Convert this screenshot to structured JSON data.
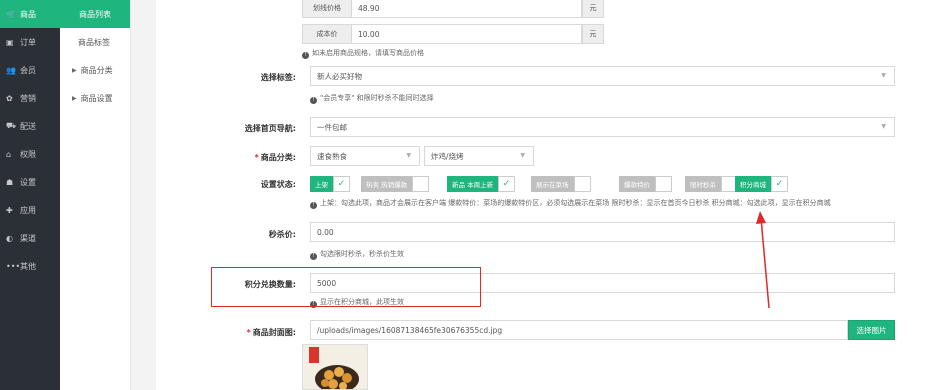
{
  "nav_primary": [
    {
      "icon": "cart-icon",
      "glyph": "🛒",
      "label": "商品",
      "active": true
    },
    {
      "icon": "order-icon",
      "glyph": "▣",
      "label": "订单"
    },
    {
      "icon": "member-icon",
      "glyph": "👥",
      "label": "会员"
    },
    {
      "icon": "marketing-icon",
      "glyph": "✿",
      "label": "营销"
    },
    {
      "icon": "delivery-icon",
      "glyph": "⛟",
      "label": "配送"
    },
    {
      "icon": "permission-icon",
      "glyph": "⌂",
      "label": "权限"
    },
    {
      "icon": "settings-icon",
      "glyph": "☗",
      "label": "设置"
    },
    {
      "icon": "app-icon",
      "glyph": "✚",
      "label": "应用"
    },
    {
      "icon": "channel-icon",
      "glyph": "◐",
      "label": "渠道"
    },
    {
      "icon": "more-icon",
      "glyph": "•••",
      "label": "其他"
    }
  ],
  "nav_secondary": {
    "product_list": "商品列表",
    "product_tags": "商品标签",
    "product_category": "商品分类",
    "product_settings": "商品设置"
  },
  "form": {
    "strike_price": {
      "addon": "划线价格",
      "value": "48.90",
      "unit": "元"
    },
    "cost_price": {
      "addon": "成本价",
      "value": "10.00",
      "unit": "元"
    },
    "price_help": "如未启用商品规格，请填写商品价格",
    "tag": {
      "label": "选择标签:",
      "value": "新人必买好物",
      "help": "\"会员专享\" 和限时秒杀不能同时选择"
    },
    "home_nav": {
      "label": "选择首页导航:",
      "value": "一件包邮"
    },
    "category": {
      "label": "商品分类:",
      "value1": "速食熟食",
      "value2": "炸鸡/烧烤"
    },
    "status": {
      "label": "设置状态:",
      "switches": [
        {
          "label": "上架",
          "on": true
        },
        {
          "label": "热卖 热销爆款",
          "on": false
        },
        {
          "label": "新品 本周上新",
          "on": true
        },
        {
          "label": "展示在菜场",
          "on": false
        },
        {
          "label": "爆款特价",
          "on": false
        },
        {
          "label": "限时秒杀",
          "on": false
        },
        {
          "label": "积分商城",
          "on": true
        }
      ],
      "help": "上架：勾选此项，商品才会展示在客户端    爆款特价：菜场的爆款特价区，必须勾选展示在菜场    限时秒杀：显示在首页今日秒杀    积分商城：勾选此项，显示在积分商城"
    },
    "seckill": {
      "label": "秒杀价:",
      "value": "0.00",
      "help": "勾选限时秒杀，秒杀价生效"
    },
    "points": {
      "label": "积分兑换数量:",
      "value": "5000",
      "help": "显示在积分商城，此项生效"
    },
    "cover": {
      "label": "商品封面图:",
      "value": "/uploads/images/16087138465fe30676355cd.jpg",
      "button": "选择图片"
    }
  },
  "colors": {
    "accent": "#1fb57f",
    "annotation": "#e02a2a",
    "nav_bg": "#2b3036"
  }
}
